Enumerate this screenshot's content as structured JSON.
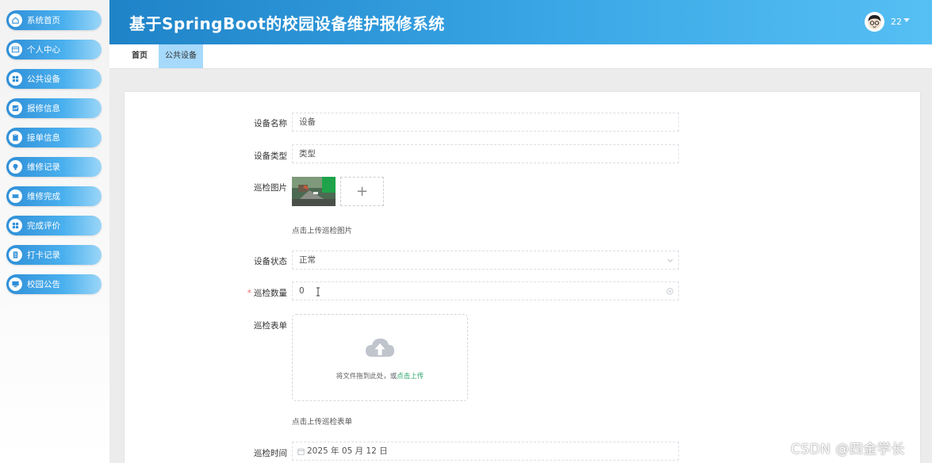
{
  "sidebar": {
    "items": [
      {
        "label": "系统首页",
        "icon": "home-icon"
      },
      {
        "label": "个人中心",
        "icon": "profile-card-icon"
      },
      {
        "label": "公共设备",
        "icon": "grid-icon"
      },
      {
        "label": "报修信息",
        "icon": "chart-icon"
      },
      {
        "label": "接单信息",
        "icon": "clipboard-icon"
      },
      {
        "label": "维修记录",
        "icon": "bulb-icon"
      },
      {
        "label": "维修完成",
        "icon": "ticket-icon"
      },
      {
        "label": "完成评价",
        "icon": "grid-icon"
      },
      {
        "label": "打卡记录",
        "icon": "document-icon"
      },
      {
        "label": "校园公告",
        "icon": "monitor-icon"
      }
    ]
  },
  "header": {
    "title": "基于SpringBoot的校园设备维护报修系统",
    "user_name": "22"
  },
  "tabs": [
    {
      "label": "首页"
    },
    {
      "label": "公共设备"
    }
  ],
  "form": {
    "name": {
      "label": "设备名称",
      "value": "设备"
    },
    "type": {
      "label": "设备类型",
      "value": "类型"
    },
    "image": {
      "label": "巡检图片",
      "hint": "点击上传巡检图片"
    },
    "status": {
      "label": "设备状态",
      "value": "正常"
    },
    "count": {
      "label": "巡检数量",
      "value": "0",
      "required_mark": "*"
    },
    "sheet": {
      "label": "巡检表单",
      "drop_text": "将文件拖到此处，或",
      "drop_link": "点击上传",
      "hint": "点击上传巡检表单"
    },
    "time": {
      "label": "巡检时间",
      "value": "2025 年 05 月 12 日"
    }
  },
  "watermark": "CSDN @四金学长",
  "colors": {
    "accent": "#3aa7e6",
    "nav": "#2f8fd8",
    "tab_active": "#a6d9fb",
    "link": "#2aa56a",
    "required": "#f56c6c"
  }
}
